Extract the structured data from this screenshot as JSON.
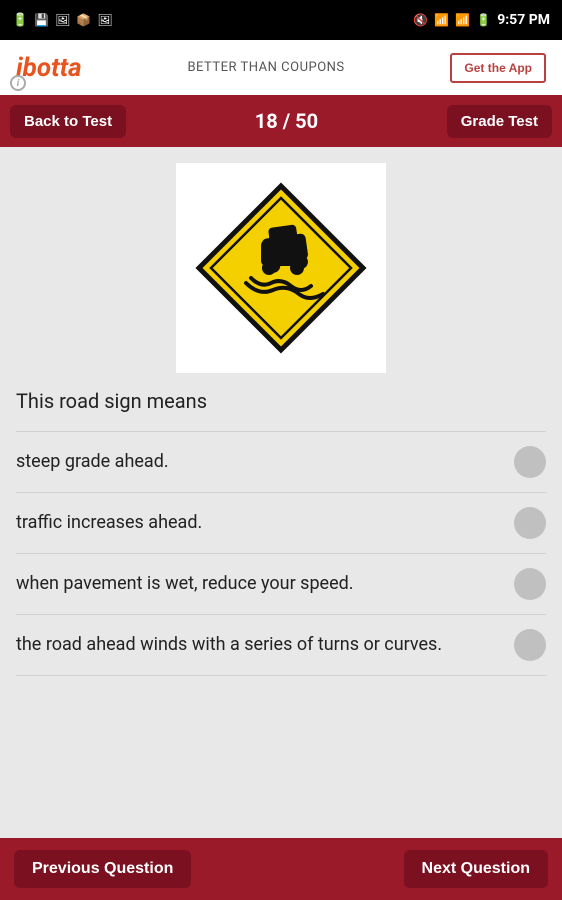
{
  "statusBar": {
    "time": "9:57 PM"
  },
  "adBanner": {
    "logo": "ibotta",
    "tagline": "BETTER THAN COUPONS",
    "buttonLabel": "Get the App",
    "infoIcon": "i"
  },
  "navBar": {
    "backLabel": "Back to Test",
    "progress": "18 / 50",
    "gradeLabel": "Grade Test"
  },
  "question": {
    "imageAlt": "Slippery road sign - yellow diamond with car sliding",
    "text": "This road sign means"
  },
  "answers": [
    {
      "id": 1,
      "text": "steep grade ahead."
    },
    {
      "id": 2,
      "text": "traffic increases ahead."
    },
    {
      "id": 3,
      "text": "when pavement is wet, reduce your speed."
    },
    {
      "id": 4,
      "text": "the road ahead winds with a series of turns or curves."
    }
  ],
  "bottomNav": {
    "prevLabel": "Previous Question",
    "nextLabel": "Next Question"
  }
}
